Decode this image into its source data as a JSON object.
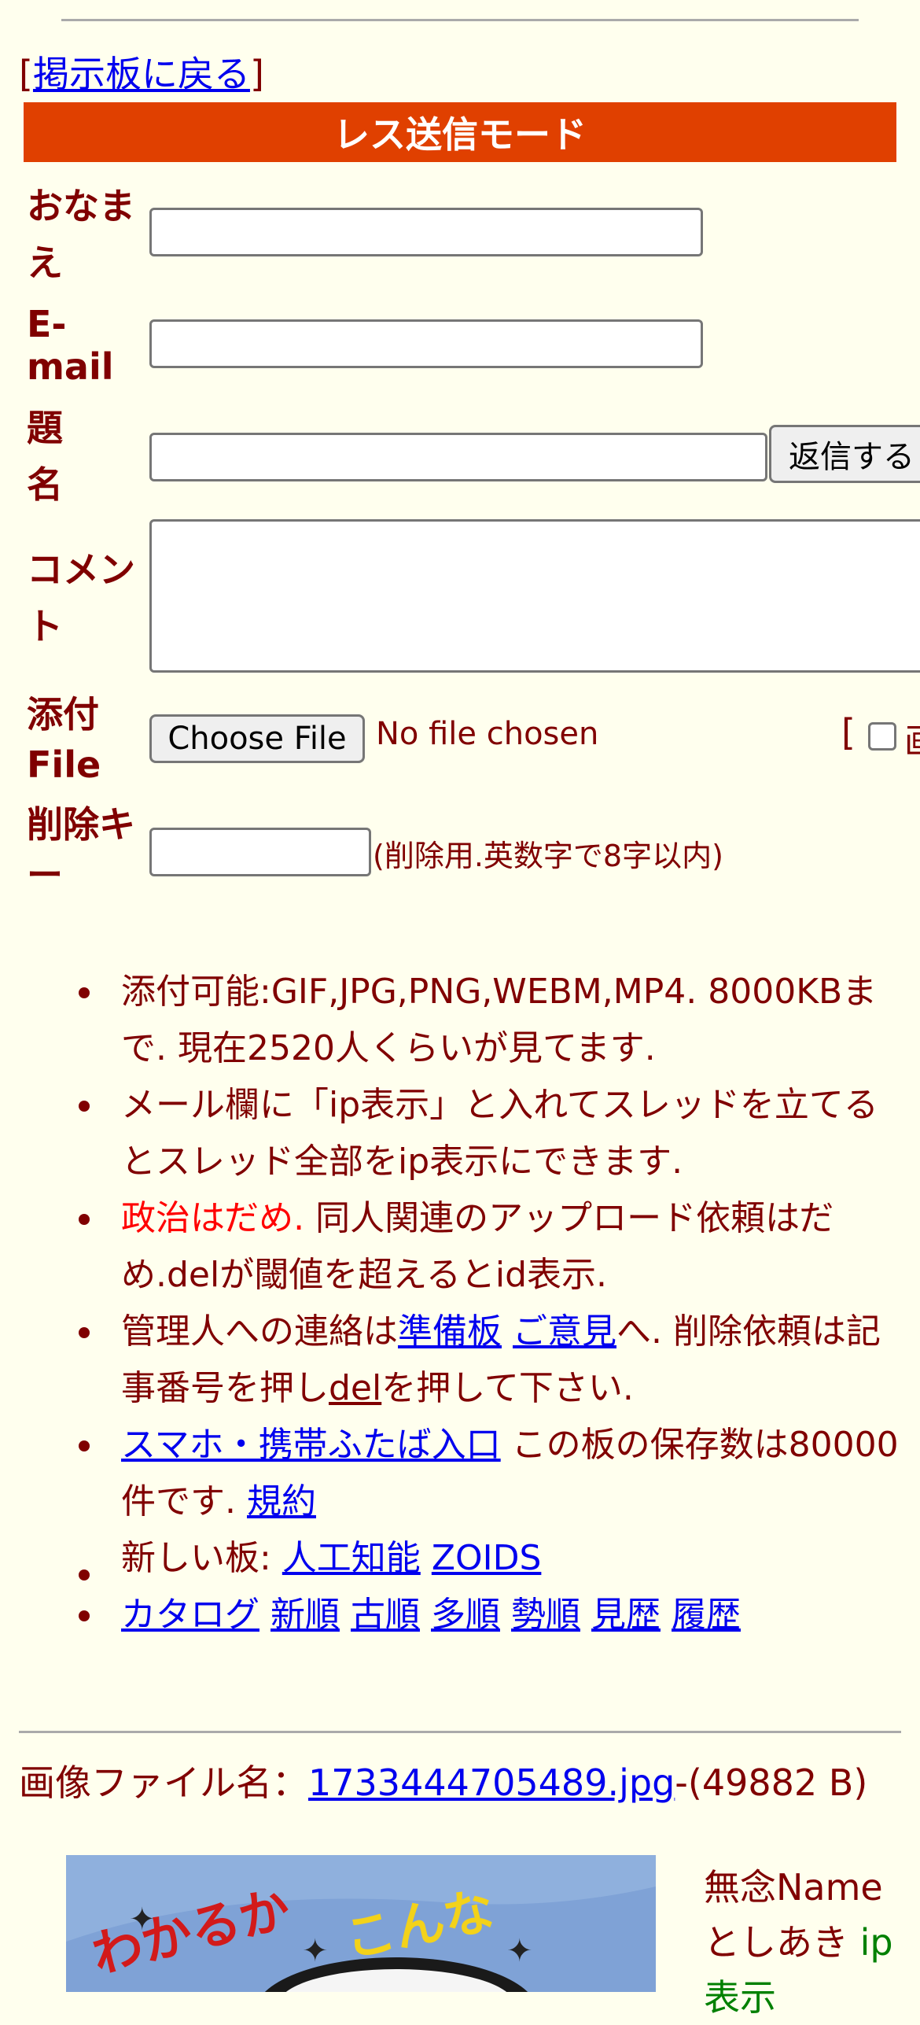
{
  "back": {
    "open": "[",
    "link": "掲示板に戻る",
    "close": "]"
  },
  "mode_title": "レス送信モード",
  "form": {
    "name_label_1": "おなま",
    "name_label_2": "え",
    "email_label_1": "E-",
    "email_label_2": "mail",
    "subject_label_1": "題",
    "subject_label_2": "名",
    "submit": "返信する",
    "comment_label_1": "コメン",
    "comment_label_2": "ト",
    "file_label_1": "添付",
    "file_label_2": "File",
    "choose_file": "Choose File",
    "no_file": "No file chosen",
    "bracket": "[",
    "image_option_partial": "画",
    "delkey_label_1": "削除キ",
    "delkey_label_2": "ー",
    "delkey_note": "(削除用.英数字で8字以内)"
  },
  "notes": {
    "n1": "添付可能:GIF,JPG,PNG,WEBM,MP4. 8000KBまで. 現在2520人くらいが見てます.",
    "n2": "メール欄に「ip表示」と入れてスレッドを立てるとスレッド全部をip表示にできます.",
    "n3_red": "政治はだめ.",
    "n3_rest": " 同人関連のアップロード依頼はだめ.delが閾値を超えるとid表示.",
    "n4_a": "管理人への連絡は",
    "n4_link1": "準備板",
    "n4_link2": "ご意見",
    "n4_b": "へ. 削除依頼は記事番号を押し",
    "n4_del": "del",
    "n4_c": "を押して下さい.",
    "n5_link": "スマホ・携帯ふたば入口",
    "n5_text": " この板の保存数は80000件です. ",
    "n5_terms": "規約",
    "n6_text": "新しい板: ",
    "n6_link1": "人工知能",
    "n6_link2": "ZOIDS",
    "nav": [
      "カタログ",
      "新順",
      "古順",
      "多順",
      "勢順",
      "見歴",
      "履歴"
    ]
  },
  "post": {
    "file_prefix": "画像ファイル名：",
    "file_name": "1733444705489.jpg",
    "file_size": "-(49882 B)",
    "name_line": "無念Name",
    "poster": "としあき",
    "ip": "ip",
    "ip_tail": "表示"
  }
}
